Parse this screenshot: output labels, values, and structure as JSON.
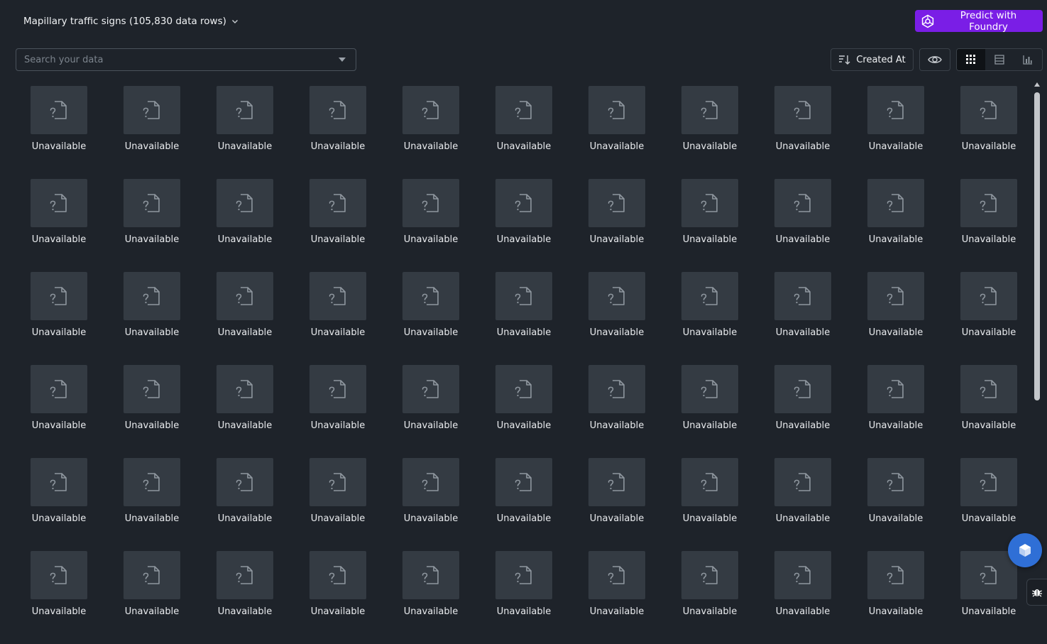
{
  "header": {
    "dataset_title": "Mapillary traffic signs (105,830 data rows)",
    "predict_button_label": "Predict with Foundry"
  },
  "toolbar": {
    "search_placeholder": "Search your data",
    "sort_label": "Created At",
    "views": [
      "grid-view-icon",
      "list-view-icon",
      "chart-view-icon"
    ],
    "active_view": "grid"
  },
  "grid": {
    "item_label": "Unavailable",
    "columns": 11,
    "rows_visible": 6,
    "placeholder_icon": "file-unknown-icon"
  },
  "colors": {
    "background": "#1e232a",
    "tile": "#343b43",
    "accent": "#7a1ee6",
    "fab": "#2f6fd6"
  }
}
